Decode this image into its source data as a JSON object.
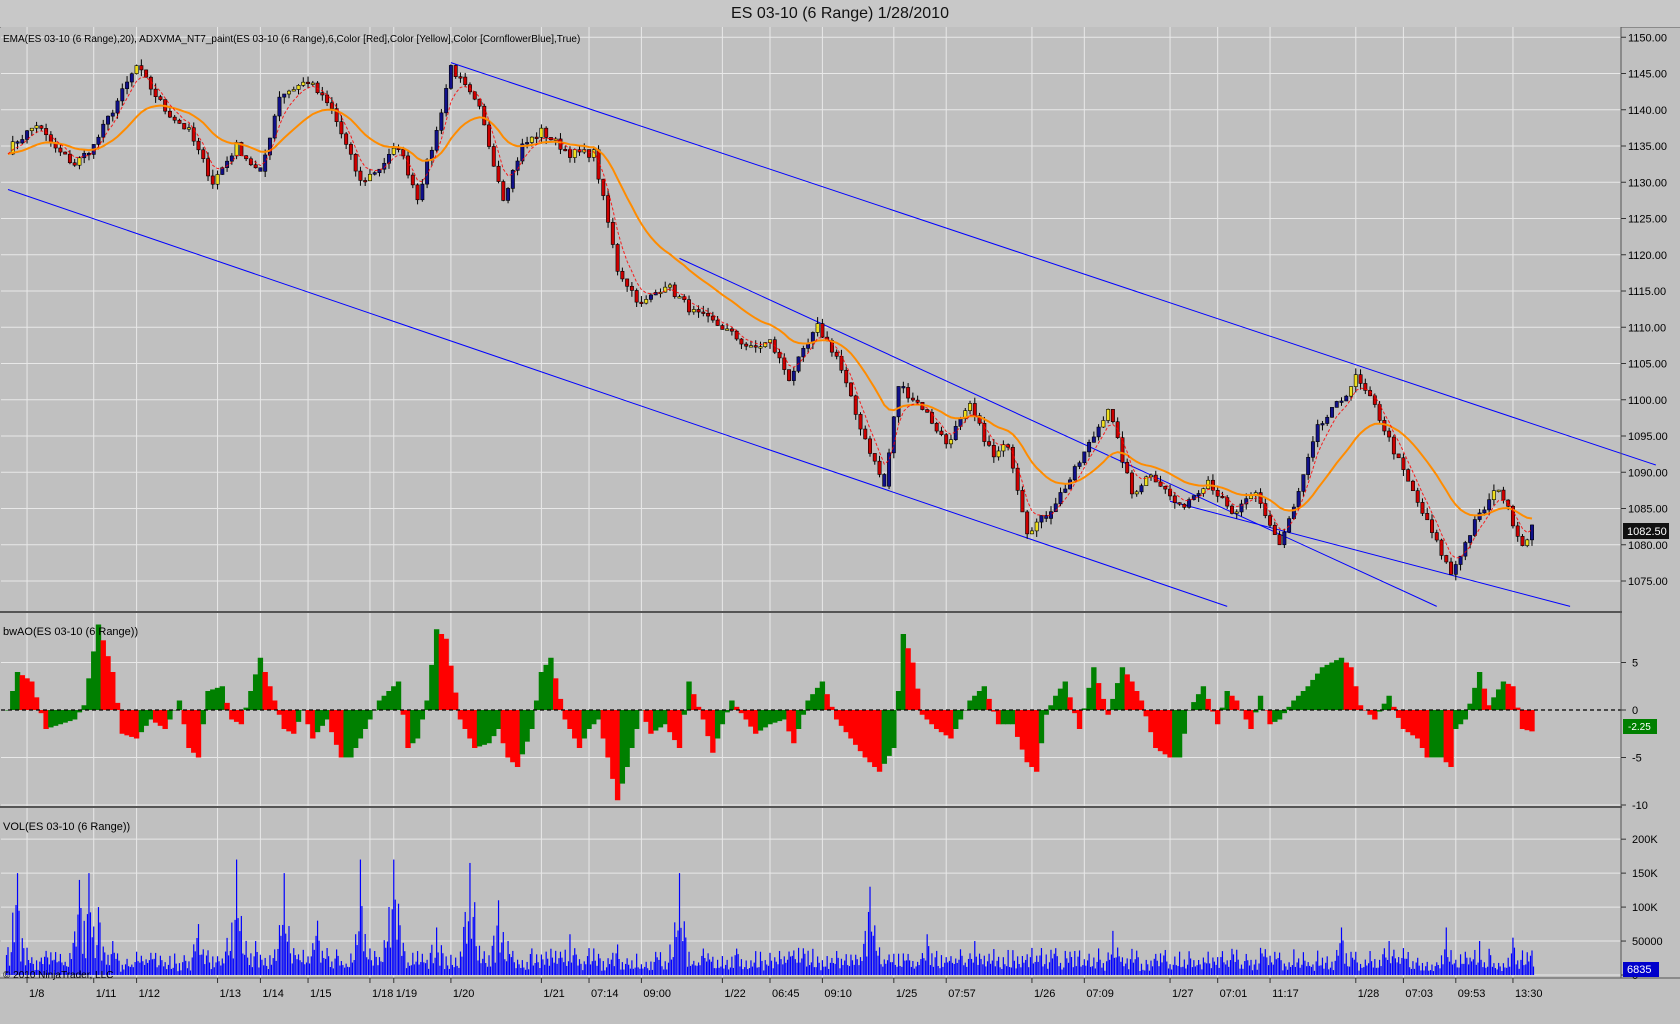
{
  "window": {
    "title": "ES 03-10 (6 Range)  1/28/2010"
  },
  "panels": {
    "price": {
      "label": "EMA(ES 03-10 (6 Range),20), ADXVMA_NT7_paint(ES 03-10 (6 Range),6,Color [Red],Color [Yellow],Color [CornflowerBlue],True)",
      "current_price": "1082.50"
    },
    "osc": {
      "label": "bwAO(ES 03-10 (6 Range))",
      "current_value": "-2.25"
    },
    "volume": {
      "label": "VOL(ES 03-10 (6 Range))",
      "current_value": "6835",
      "watermark": "© 2010 NinjaTrader, LLC"
    }
  },
  "colors": {
    "background": "#c0c0c0",
    "grid": "#e8e8e8",
    "bear_candle": "#cc0000",
    "bull_candle": "#f0e020",
    "strong_candle": "#10108a",
    "ema": "#ff8c00",
    "adxvma_down": "#ff0000",
    "ao_up": "#008000",
    "ao_down": "#ff0000",
    "volume": "#0000ff",
    "trend_channel": "#0000ff"
  },
  "chart_data": [
    {
      "type": "candlestick",
      "title": "ES 03-10 (6 Range)  1/28/2010",
      "ylim": [
        1071,
        1151
      ],
      "y_ticks": [
        "1150.00",
        "1145.00",
        "1140.00",
        "1135.00",
        "1130.00",
        "1125.00",
        "1120.00",
        "1115.00",
        "1110.00",
        "1105.00",
        "1100.00",
        "1095.00",
        "1090.00",
        "1085.00",
        "1080.00",
        "1075.00"
      ],
      "x_tick_labels": [
        "1/8",
        "1/11",
        "1/12",
        "1/13",
        "1/14",
        "1/15",
        "1/18",
        "1/19",
        "1/20",
        "1/21",
        "07:14",
        "09:00",
        "1/22",
        "06:45",
        "09:10",
        "1/25",
        "07:57",
        "1/26",
        "07:09",
        "1/27",
        "07:01",
        "11:17",
        "1/28",
        "07:03",
        "09:53",
        "13:30"
      ],
      "x_tick_index": [
        4,
        18,
        27,
        44,
        53,
        63,
        76,
        81,
        93,
        112,
        122,
        133,
        150,
        160,
        171,
        186,
        197,
        215,
        226,
        244,
        254,
        265,
        283,
        293,
        304,
        316
      ],
      "close_path": [
        [
          0,
          1134.5
        ],
        [
          6,
          1138
        ],
        [
          10,
          1134.5
        ],
        [
          14,
          1132.5
        ],
        [
          18,
          1135
        ],
        [
          22,
          1140
        ],
        [
          27,
          1146
        ],
        [
          33,
          1140
        ],
        [
          38,
          1137
        ],
        [
          43,
          1130
        ],
        [
          48,
          1135
        ],
        [
          53,
          1131
        ],
        [
          57,
          1142
        ],
        [
          63,
          1144
        ],
        [
          68,
          1140
        ],
        [
          74,
          1130
        ],
        [
          78,
          1132
        ],
        [
          82,
          1135
        ],
        [
          86,
          1128
        ],
        [
          90,
          1137
        ],
        [
          93,
          1146
        ],
        [
          99,
          1140
        ],
        [
          104,
          1128
        ],
        [
          108,
          1135
        ],
        [
          112,
          1137
        ],
        [
          118,
          1134
        ],
        [
          123,
          1134
        ],
        [
          128,
          1118
        ],
        [
          133,
          1113
        ],
        [
          138,
          1116
        ],
        [
          144,
          1112
        ],
        [
          150,
          1110
        ],
        [
          156,
          1107
        ],
        [
          160,
          1108
        ],
        [
          164,
          1103
        ],
        [
          170,
          1110
        ],
        [
          174,
          1106
        ],
        [
          178,
          1098
        ],
        [
          184,
          1088
        ],
        [
          187,
          1102
        ],
        [
          192,
          1099
        ],
        [
          197,
          1094
        ],
        [
          202,
          1099
        ],
        [
          207,
          1092
        ],
        [
          210,
          1094
        ],
        [
          214,
          1082
        ],
        [
          218,
          1084
        ],
        [
          223,
          1089
        ],
        [
          228,
          1095
        ],
        [
          231,
          1099
        ],
        [
          236,
          1087
        ],
        [
          240,
          1090
        ],
        [
          246,
          1085
        ],
        [
          252,
          1089
        ],
        [
          257,
          1084
        ],
        [
          262,
          1087
        ],
        [
          267,
          1080
        ],
        [
          270,
          1085
        ],
        [
          275,
          1096
        ],
        [
          280,
          1100
        ],
        [
          283,
          1103
        ],
        [
          287,
          1099
        ],
        [
          293,
          1090
        ],
        [
          298,
          1083
        ],
        [
          303,
          1076
        ],
        [
          308,
          1083
        ],
        [
          313,
          1088
        ],
        [
          318,
          1080
        ],
        [
          320,
          1082.5
        ]
      ],
      "trend_lines": [
        {
          "from": [
            0,
            1129
          ],
          "to": [
            256,
            1071.5
          ]
        },
        {
          "from": [
            93,
            1146.5
          ],
          "to": [
            346,
            1091
          ]
        },
        {
          "from": [
            141,
            1119.5
          ],
          "to": [
            300,
            1071.5
          ]
        },
        {
          "from": [
            244,
            1086
          ],
          "to": [
            328,
            1071.5
          ]
        }
      ]
    },
    {
      "type": "area",
      "title": "bwAO(ES 03-10 (6 Range))",
      "ylim": [
        -10,
        10
      ],
      "y_ticks": [
        "5",
        "0",
        "-5",
        "-10"
      ],
      "baseline": 0,
      "path": [
        [
          0,
          0
        ],
        [
          2,
          4
        ],
        [
          5,
          3
        ],
        [
          8,
          -2
        ],
        [
          11,
          -1.5
        ],
        [
          14,
          -1
        ],
        [
          16,
          0.5
        ],
        [
          19,
          9
        ],
        [
          22,
          4
        ],
        [
          24,
          -2.5
        ],
        [
          27,
          -3
        ],
        [
          30,
          -1
        ],
        [
          33,
          -2
        ],
        [
          36,
          1
        ],
        [
          38,
          -4
        ],
        [
          40,
          -5
        ],
        [
          42,
          2
        ],
        [
          45,
          2.5
        ],
        [
          47,
          -1
        ],
        [
          49,
          -1.5
        ],
        [
          51,
          2
        ],
        [
          53,
          5.5
        ],
        [
          56,
          1
        ],
        [
          58,
          -2
        ],
        [
          60,
          -2.5
        ],
        [
          62,
          0
        ],
        [
          64,
          -3
        ],
        [
          67,
          -1
        ],
        [
          70,
          -5
        ],
        [
          72,
          -5
        ],
        [
          74,
          -3
        ],
        [
          76,
          -1
        ],
        [
          78,
          1
        ],
        [
          80,
          2
        ],
        [
          82,
          3
        ],
        [
          84,
          -4
        ],
        [
          86,
          -3
        ],
        [
          88,
          1
        ],
        [
          90,
          8.5
        ],
        [
          92,
          7.5
        ],
        [
          95,
          -1
        ],
        [
          98,
          -4
        ],
        [
          101,
          -3.5
        ],
        [
          103,
          -2
        ],
        [
          105,
          -5
        ],
        [
          107,
          -6
        ],
        [
          110,
          -2
        ],
        [
          112,
          4
        ],
        [
          114,
          5.5
        ],
        [
          117,
          -1
        ],
        [
          120,
          -4
        ],
        [
          122,
          -2
        ],
        [
          124,
          -1
        ],
        [
          126,
          -5
        ],
        [
          128,
          -9.5
        ],
        [
          130,
          -6
        ],
        [
          133,
          0
        ],
        [
          135,
          -2.5
        ],
        [
          138,
          -1.5
        ],
        [
          141,
          -4
        ],
        [
          143,
          3
        ],
        [
          146,
          -1
        ],
        [
          148,
          -4.5
        ],
        [
          150,
          -1.5
        ],
        [
          152,
          1
        ],
        [
          155,
          -1
        ],
        [
          157,
          -2.5
        ],
        [
          160,
          -1.5
        ],
        [
          163,
          -1
        ],
        [
          165,
          -3.5
        ],
        [
          168,
          1
        ],
        [
          171,
          3
        ],
        [
          174,
          -1
        ],
        [
          177,
          -3
        ],
        [
          180,
          -5
        ],
        [
          183,
          -6.5
        ],
        [
          186,
          -4
        ],
        [
          188,
          8
        ],
        [
          190,
          5
        ],
        [
          192,
          -0.5
        ],
        [
          195,
          -2
        ],
        [
          198,
          -3
        ],
        [
          202,
          1
        ],
        [
          205,
          2.5
        ],
        [
          208,
          -1.5
        ],
        [
          211,
          -1.5
        ],
        [
          214,
          -5.5
        ],
        [
          216,
          -6.5
        ],
        [
          218,
          -0.5
        ],
        [
          220,
          1.5
        ],
        [
          222,
          3
        ],
        [
          225,
          -2
        ],
        [
          228,
          4.5
        ],
        [
          231,
          -0.5
        ],
        [
          234,
          4.5
        ],
        [
          236,
          3
        ],
        [
          238,
          1
        ],
        [
          241,
          -4
        ],
        [
          244,
          -5
        ],
        [
          246,
          -5
        ],
        [
          248,
          0
        ],
        [
          251,
          2.5
        ],
        [
          254,
          -1.5
        ],
        [
          256,
          2
        ],
        [
          258,
          1
        ],
        [
          261,
          -2
        ],
        [
          263,
          1.5
        ],
        [
          265,
          -1.5
        ],
        [
          267,
          -1
        ],
        [
          270,
          1
        ],
        [
          273,
          2.5
        ],
        [
          276,
          4.5
        ],
        [
          278,
          5
        ],
        [
          280,
          5.5
        ],
        [
          282,
          4.5
        ],
        [
          284,
          0.5
        ],
        [
          287,
          -1
        ],
        [
          290,
          1.5
        ],
        [
          293,
          -2
        ],
        [
          296,
          -3
        ],
        [
          298,
          -5
        ],
        [
          301,
          -5
        ],
        [
          303,
          -6
        ],
        [
          304,
          -2
        ],
        [
          306,
          -1
        ],
        [
          309,
          4
        ],
        [
          311,
          0.5
        ],
        [
          314,
          3
        ],
        [
          316,
          2.5
        ],
        [
          318,
          -2
        ],
        [
          320,
          -2.25
        ]
      ]
    },
    {
      "type": "bar",
      "title": "VOL(ES 03-10 (6 Range))",
      "ylim": [
        0,
        240000
      ],
      "y_ticks": [
        "200K",
        "150K",
        "100K",
        "50000",
        "0"
      ],
      "peaks": [
        [
          2,
          150000
        ],
        [
          15,
          140000
        ],
        [
          17,
          150000
        ],
        [
          19,
          100000
        ],
        [
          22,
          50000
        ],
        [
          40,
          75000
        ],
        [
          48,
          170000
        ],
        [
          52,
          50000
        ],
        [
          58,
          150000
        ],
        [
          65,
          80000
        ],
        [
          74,
          170000
        ],
        [
          81,
          170000
        ],
        [
          90,
          70000
        ],
        [
          97,
          165000
        ],
        [
          103,
          110000
        ],
        [
          105,
          50000
        ],
        [
          118,
          60000
        ],
        [
          128,
          45000
        ],
        [
          141,
          150000
        ],
        [
          153,
          25000
        ],
        [
          166,
          40000
        ],
        [
          176,
          30000
        ],
        [
          181,
          130000
        ],
        [
          193,
          60000
        ],
        [
          203,
          50000
        ],
        [
          220,
          30000
        ],
        [
          232,
          65000
        ],
        [
          248,
          35000
        ],
        [
          263,
          40000
        ],
        [
          280,
          70000
        ],
        [
          290,
          50000
        ],
        [
          302,
          70000
        ],
        [
          309,
          50000
        ],
        [
          316,
          55000
        ],
        [
          320,
          6835
        ]
      ]
    }
  ]
}
